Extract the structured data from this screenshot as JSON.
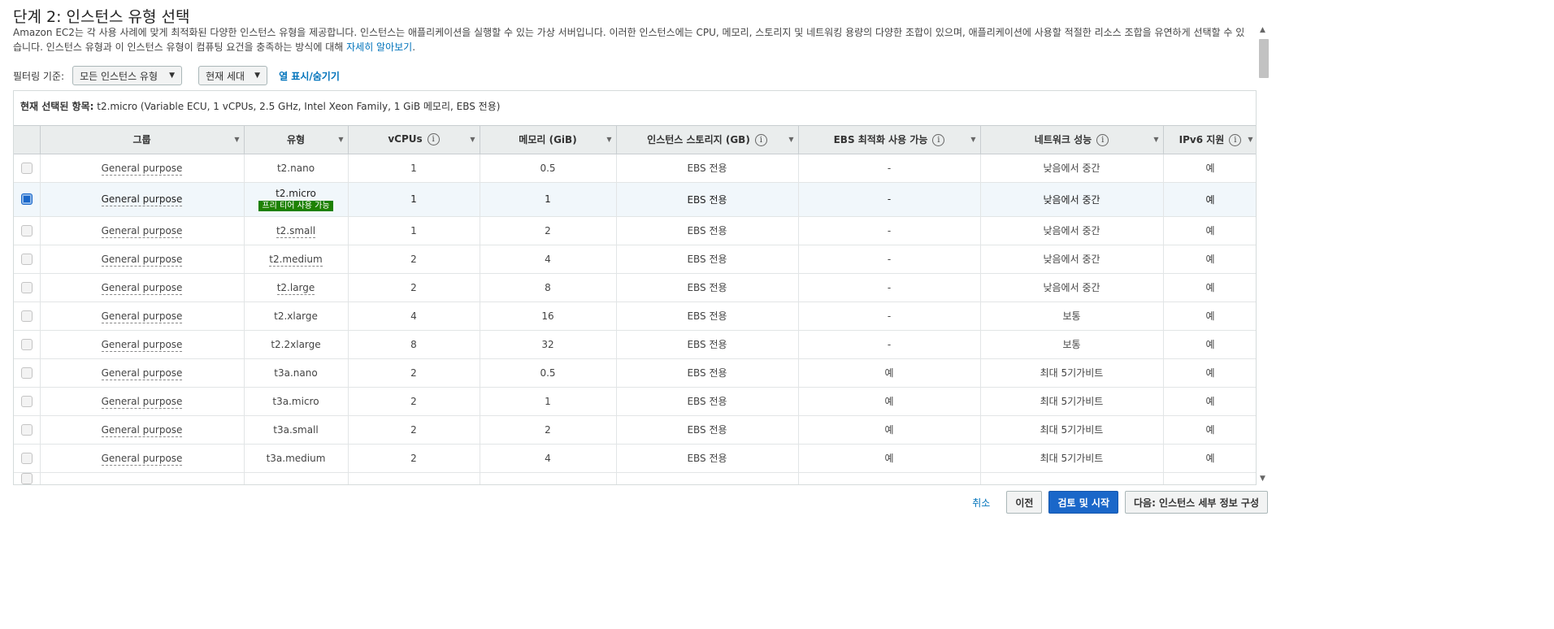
{
  "page": {
    "title": "단계 2: 인스턴스 유형 선택",
    "intro": "Amazon EC2는 각 사용 사례에 맞게 최적화된 다양한 인스턴스 유형을 제공합니다. 인스턴스는 애플리케이션을 실행할 수 있는 가상 서버입니다. 이러한 인스턴스에는 CPU, 메모리, 스토리지 및 네트워킹 용량의 다양한 조합이 있으며, 애플리케이션에 사용할 적절한 리소스 조합을 유연하게 선택할 수 있습니다. 인스턴스 유형과 이 인스턴스 유형이 컴퓨팅 요건을 충족하는 방식에 대해 ",
    "intro_link": "자세히 알아보기",
    "intro_end": "."
  },
  "filter": {
    "label": "필터링 기준:",
    "type_select": "모든 인스턴스 유형",
    "generation_select": "현재 세대",
    "toggle_columns": "열 표시/숨기기"
  },
  "current_selection": {
    "label": "현재 선택된 항목:",
    "value": " t2.micro (Variable ECU, 1 vCPUs, 2.5 GHz, Intel Xeon Family, 1 GiB 메모리, EBS 전용)"
  },
  "table": {
    "headers": [
      "그룹",
      "유형",
      "vCPUs",
      "메모리 (GiB)",
      "인스턴스 스토리지 (GB)",
      "EBS 최적화 사용 가능",
      "네트워크 성능",
      "IPv6 지원"
    ],
    "info_glyph": "i",
    "free_tier_badge": "프리 티어 사용 가능",
    "rows": [
      {
        "group": "General purpose",
        "type": "t2.nano",
        "vcpus": "1",
        "memory": "0.5",
        "storage": "EBS 전용",
        "ebs": "-",
        "network": "낮음에서 중간",
        "ipv6": "예"
      },
      {
        "group": "General purpose",
        "type": "t2.micro",
        "vcpus": "1",
        "memory": "1",
        "storage": "EBS 전용",
        "ebs": "-",
        "network": "낮음에서 중간",
        "ipv6": "예"
      },
      {
        "group": "General purpose",
        "type": "t2.small",
        "vcpus": "1",
        "memory": "2",
        "storage": "EBS 전용",
        "ebs": "-",
        "network": "낮음에서 중간",
        "ipv6": "예"
      },
      {
        "group": "General purpose",
        "type": "t2.medium",
        "vcpus": "2",
        "memory": "4",
        "storage": "EBS 전용",
        "ebs": "-",
        "network": "낮음에서 중간",
        "ipv6": "예"
      },
      {
        "group": "General purpose",
        "type": "t2.large",
        "vcpus": "2",
        "memory": "8",
        "storage": "EBS 전용",
        "ebs": "-",
        "network": "낮음에서 중간",
        "ipv6": "예"
      },
      {
        "group": "General purpose",
        "type": "t2.xlarge",
        "vcpus": "4",
        "memory": "16",
        "storage": "EBS 전용",
        "ebs": "-",
        "network": "보통",
        "ipv6": "예"
      },
      {
        "group": "General purpose",
        "type": "t2.2xlarge",
        "vcpus": "8",
        "memory": "32",
        "storage": "EBS 전용",
        "ebs": "-",
        "network": "보통",
        "ipv6": "예"
      },
      {
        "group": "General purpose",
        "type": "t3a.nano",
        "vcpus": "2",
        "memory": "0.5",
        "storage": "EBS 전용",
        "ebs": "예",
        "network": "최대 5기가비트",
        "ipv6": "예"
      },
      {
        "group": "General purpose",
        "type": "t3a.micro",
        "vcpus": "2",
        "memory": "1",
        "storage": "EBS 전용",
        "ebs": "예",
        "network": "최대 5기가비트",
        "ipv6": "예"
      },
      {
        "group": "General purpose",
        "type": "t3a.small",
        "vcpus": "2",
        "memory": "2",
        "storage": "EBS 전용",
        "ebs": "예",
        "network": "최대 5기가비트",
        "ipv6": "예"
      },
      {
        "group": "General purpose",
        "type": "t3a.medium",
        "vcpus": "2",
        "memory": "4",
        "storage": "EBS 전용",
        "ebs": "예",
        "network": "최대 5기가비트",
        "ipv6": "예"
      }
    ]
  },
  "footer": {
    "cancel": "취소",
    "previous": "이전",
    "review_launch": "검토 및 시작",
    "next": "다음: 인스턴스 세부 정보 구성"
  },
  "colors": {
    "accent": "#0073bb",
    "primary_button": "#1a67c9",
    "free_tier": "#1d8102",
    "selected_row": "#f1f7fb"
  },
  "icons": {
    "sort": "sort-caret-icon",
    "info": "info-circle-icon",
    "dropdown": "chevron-down-icon"
  }
}
